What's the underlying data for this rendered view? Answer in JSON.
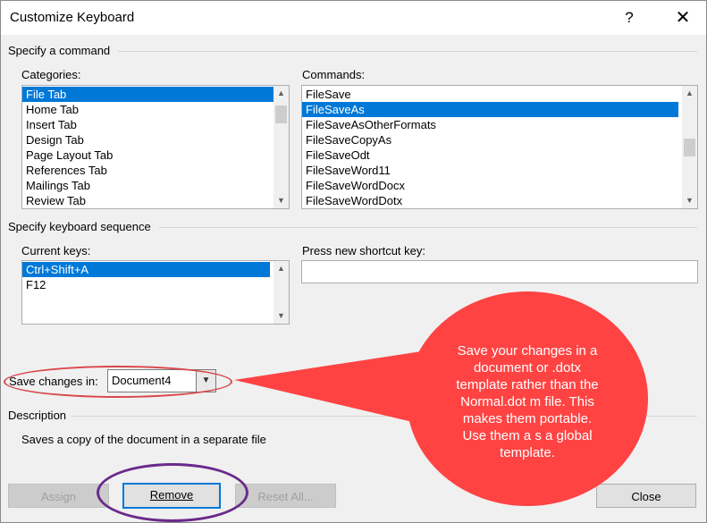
{
  "window": {
    "title": "Customize Keyboard",
    "help_glyph": "?",
    "close_glyph": "✕"
  },
  "command_section": {
    "heading": "Specify a command",
    "categories_label": "Categories:",
    "categories": [
      "File Tab",
      "Home Tab",
      "Insert Tab",
      "Design Tab",
      "Page Layout Tab",
      "References Tab",
      "Mailings Tab",
      "Review Tab"
    ],
    "selected_category": "File Tab",
    "commands_label": "Commands:",
    "commands": [
      "FileSave",
      "FileSaveAs",
      "FileSaveAsOtherFormats",
      "FileSaveCopyAs",
      "FileSaveOdt",
      "FileSaveWord11",
      "FileSaveWordDocx",
      "FileSaveWordDotx"
    ],
    "selected_command": "FileSaveAs"
  },
  "keyboard_section": {
    "heading": "Specify keyboard sequence",
    "current_keys_label": "Current keys:",
    "current_keys": [
      "Ctrl+Shift+A",
      "F12"
    ],
    "selected_key": "Ctrl+Shift+A",
    "new_shortcut_label": "Press new shortcut key:",
    "new_shortcut_value": ""
  },
  "save_changes": {
    "label": "Save changes in:",
    "value": "Document4"
  },
  "description": {
    "heading": "Description",
    "text": "Saves a copy of the document in a separate file"
  },
  "buttons": {
    "assign": "Assign",
    "remove": "Remove",
    "reset_all": "Reset All...",
    "close": "Close"
  },
  "callout": {
    "lines": [
      "Save your changes in a",
      "document or .dotx",
      "template rather than the",
      "Normal.dot m file. This",
      "makes them portable.",
      "Use them a s a global",
      "template."
    ],
    "fill_color": "#ff4343",
    "ring_color": "#d9474b",
    "remove_ring_color": "#6a2a8a"
  },
  "colors": {
    "selection": "#0078d7",
    "focus_border": "#0078d7"
  }
}
